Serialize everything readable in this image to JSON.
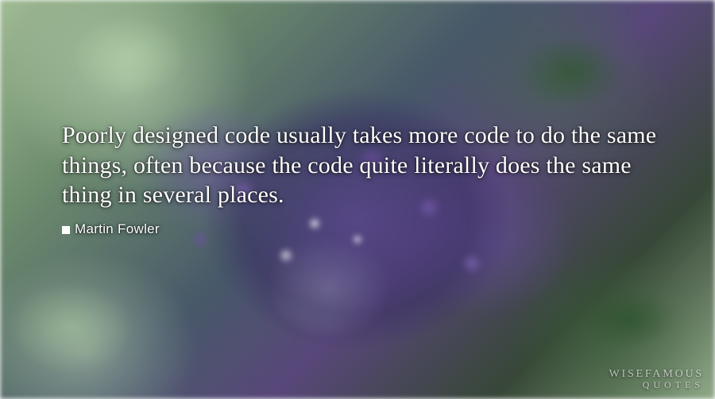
{
  "quote": {
    "text": "Poorly designed code usually takes more code to do the same things, often because the code quite literally does the same thing in several places.",
    "author": "Martin Fowler"
  },
  "watermark": {
    "line1": "WISEFAMOUS",
    "line2": "QUOTES"
  }
}
